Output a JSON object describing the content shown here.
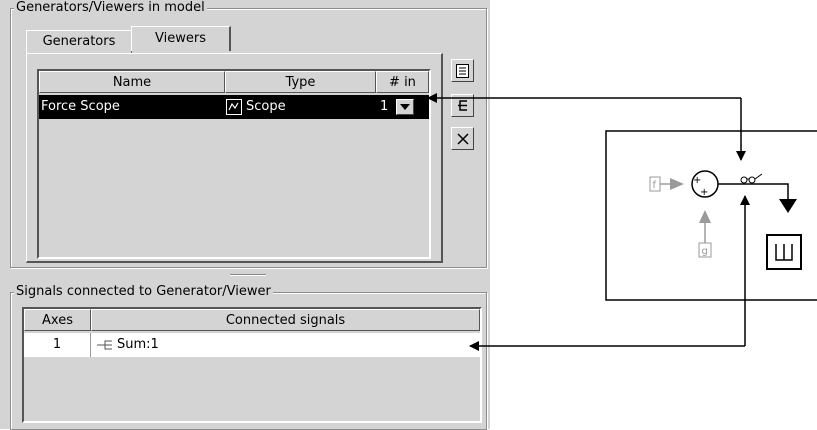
{
  "generators_panel": {
    "title": "Generators/Viewers in model",
    "tabs": [
      {
        "label": "Generators"
      },
      {
        "label": "Viewers"
      }
    ],
    "active_tab": "Viewers",
    "columns": [
      "Name",
      "Type",
      "# in"
    ],
    "rows": [
      {
        "name": "Force Scope",
        "type": "Scope",
        "num_in": "1",
        "selected": true
      }
    ],
    "side_buttons": [
      {
        "icon": "properties-icon"
      },
      {
        "icon": "signal-select-icon"
      },
      {
        "icon": "delete-icon"
      }
    ]
  },
  "signals_panel": {
    "title": "Signals connected to Generator/Viewer",
    "columns": [
      "Axes",
      "Connected signals"
    ],
    "rows": [
      {
        "axes": "1",
        "signal": "Sum:1"
      }
    ]
  },
  "diagram": {
    "input_top": "f",
    "input_bottom": "g",
    "sum_signs": "++"
  },
  "colors": {
    "panel_bg": "#d4d4d4",
    "selection_bg": "#000000",
    "selection_fg": "#ffffff",
    "block_gray": "#9a9a9a"
  }
}
